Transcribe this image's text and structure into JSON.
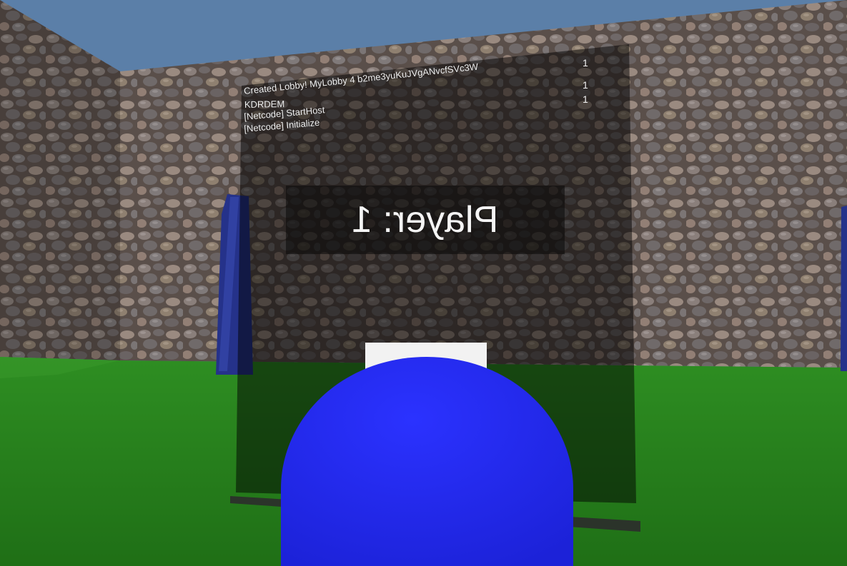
{
  "log": {
    "lines": [
      "Created Lobby! MyLobby 4 b2me3yuKuJVgANvcfSVc3W",
      "KDRDEM",
      "[Netcode] StartHost",
      "[Netcode] Initialize"
    ],
    "counts": [
      "1",
      "1",
      "1"
    ]
  },
  "hud": {
    "player_label": "Player: 1"
  },
  "colors": {
    "sky": "#5b7fa8",
    "grass": "#2f8a22",
    "capsule": "#2229f5",
    "pillar": "#25328a",
    "panel": "#000000"
  }
}
